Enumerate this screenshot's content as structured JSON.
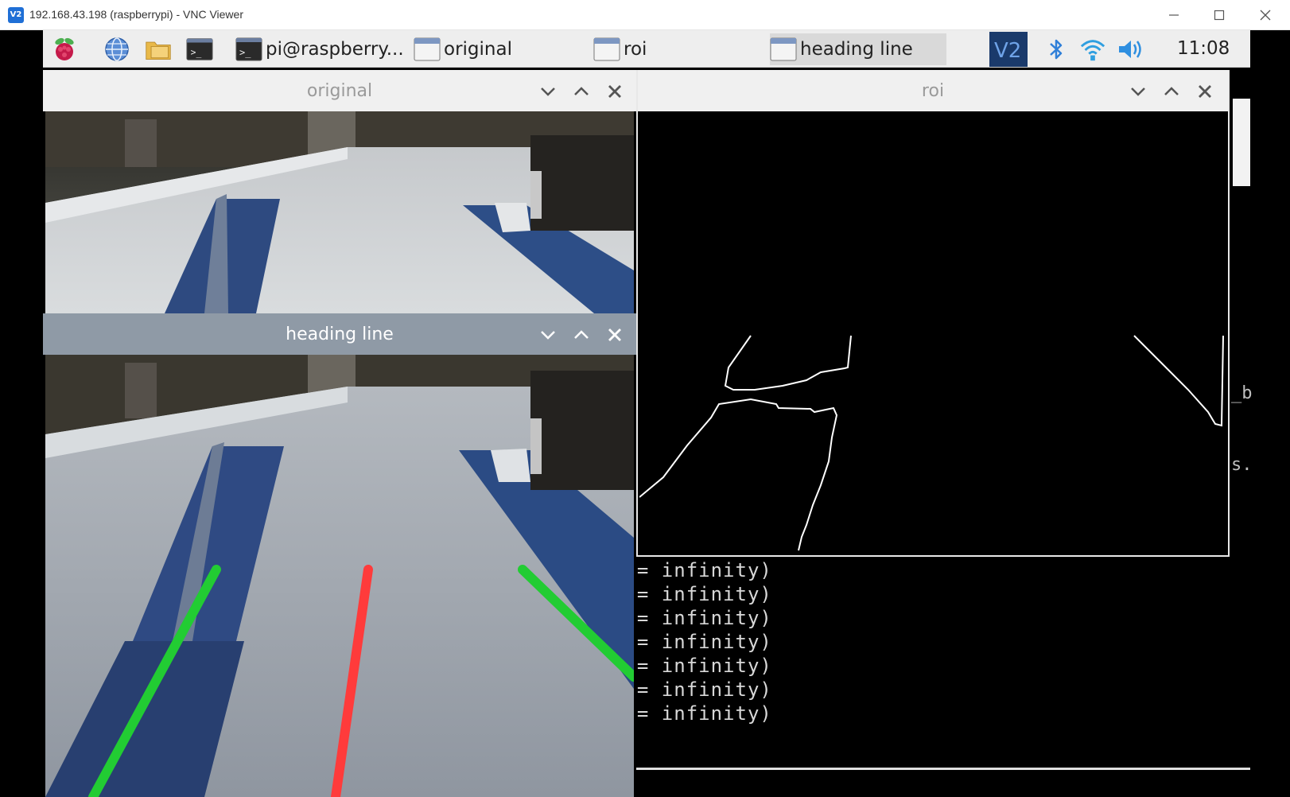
{
  "viewer": {
    "title": "192.168.43.198 (raspberrypi) - VNC Viewer",
    "logo_text": "V2",
    "minimize_glyph": "—",
    "maximize_glyph": "☐",
    "close_glyph": "✕"
  },
  "taskbar": {
    "icons": [
      "raspberry-menu-icon",
      "web-browser-icon",
      "file-manager-icon",
      "terminal-icon"
    ],
    "buttons": [
      {
        "label": "pi@raspberry...",
        "icon": "terminal-icon"
      },
      {
        "label": "original",
        "icon": "window-icon"
      },
      {
        "label": "roi",
        "icon": "window-icon"
      },
      {
        "label": "heading line",
        "icon": "window-icon",
        "active": true
      }
    ],
    "tray": [
      "vnc-icon",
      "bluetooth-icon",
      "wifi-icon",
      "volume-icon"
    ],
    "clock": "11:08"
  },
  "windows": {
    "original": {
      "title": "original"
    },
    "heading_line": {
      "title": "heading line"
    },
    "roi": {
      "title": "roi"
    }
  },
  "terminal": {
    "lines": [
      "e = infinity)",
      "e = infinity)",
      "e = infinity)",
      "e = infinity)",
      "e = infinity)",
      "e = infinity)",
      "e = infinity)"
    ],
    "partial_line": "e = infinity)",
    "fragment_b": "_b",
    "fragment_s": "s."
  },
  "colors": {
    "left_lane_line": "#22cc33",
    "right_lane_line": "#22cc33",
    "heading_line": "#ff3b3b",
    "active_titlebar": "#8f9aa6",
    "inactive_titlebar": "#f0f0f0"
  }
}
